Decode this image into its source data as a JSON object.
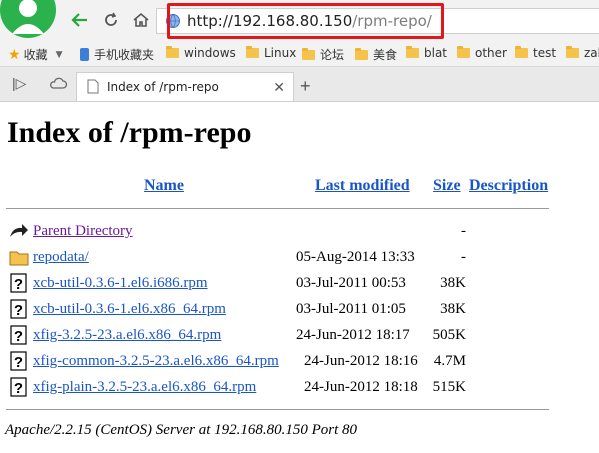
{
  "browser": {
    "url_host": "http://192.168.80.150",
    "url_path": "/rpm-repo/",
    "bookmarks": [
      {
        "label": "收藏",
        "type": "star"
      },
      {
        "label": "手机收藏夹",
        "type": "phone"
      },
      {
        "label": "windows",
        "type": "folder"
      },
      {
        "label": "Linux",
        "type": "folder"
      },
      {
        "label": "论坛",
        "type": "folder"
      },
      {
        "label": "美食",
        "type": "folder"
      },
      {
        "label": "blat",
        "type": "folder"
      },
      {
        "label": "other",
        "type": "folder"
      },
      {
        "label": "test",
        "type": "folder"
      },
      {
        "label": "zab",
        "type": "folder"
      }
    ],
    "tab_title": "Index of /rpm-repo"
  },
  "page": {
    "title": "Index of /rpm-repo",
    "columns": {
      "name": "Name",
      "modified": "Last modified",
      "size": "Size",
      "description": "Description"
    },
    "rows": [
      {
        "name": "Parent Directory",
        "modified": "",
        "size": "-",
        "icon": "back-folder-icon"
      },
      {
        "name": "repodata/",
        "modified": "05-Aug-2014 13:33",
        "size": "-",
        "icon": "folder-icon"
      },
      {
        "name": "xcb-util-0.3.6-1.el6.i686.rpm",
        "modified": "03-Jul-2011 00:53",
        "size": "38K",
        "icon": "unknown-file-icon"
      },
      {
        "name": "xcb-util-0.3.6-1.el6.x86_64.rpm",
        "modified": "03-Jul-2011 01:05",
        "size": "38K",
        "icon": "unknown-file-icon"
      },
      {
        "name": "xfig-3.2.5-23.a.el6.x86_64.rpm",
        "modified": "24-Jun-2012 18:17",
        "size": "505K",
        "icon": "unknown-file-icon"
      },
      {
        "name": "xfig-common-3.2.5-23.a.el6.x86_64.rpm",
        "modified": "24-Jun-2012 18:16",
        "size": "4.7M",
        "icon": "unknown-file-icon"
      },
      {
        "name": "xfig-plain-3.2.5-23.a.el6.x86_64.rpm",
        "modified": "24-Jun-2012 18:18",
        "size": "515K",
        "icon": "unknown-file-icon"
      }
    ],
    "footer": "Apache/2.2.15 (CentOS) Server at 192.168.80.150 Port 80"
  },
  "colors": {
    "link": "#1a55c8",
    "visited": "#6a1b9a",
    "highlight": "#e0171b",
    "avatar": "#2bb24c"
  }
}
